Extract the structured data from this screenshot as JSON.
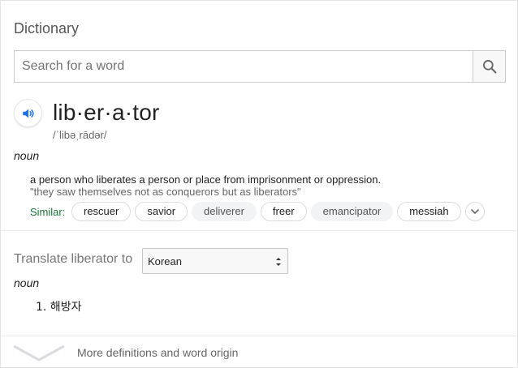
{
  "dictionary": {
    "title": "Dictionary",
    "search": {
      "placeholder": "Search for a word",
      "value": ""
    }
  },
  "entry": {
    "headword": "lib·er·a·tor",
    "phonetic": "/ˈlibəˌrādər/",
    "part_of_speech": "noun",
    "definition": "a person who liberates a person or place from imprisonment or oppression.",
    "example": "\"they saw themselves not as conquerors but as liberators\"",
    "similar_label": "Similar:",
    "similar": [
      "rescuer",
      "savior",
      "deliverer",
      "freer",
      "emancipator",
      "messiah"
    ]
  },
  "translate": {
    "label": "Translate liberator to",
    "selected_language": "Korean",
    "part_of_speech": "noun",
    "items": [
      "1. 해방자"
    ]
  },
  "footer": {
    "more_label": "More definitions and word origin"
  },
  "icons": {
    "search": "search-icon",
    "speaker": "speaker-icon",
    "chevron": "chevron-down-icon"
  },
  "colors": {
    "accent_blue": "#1a73e8",
    "similar_green": "#1a7a3c"
  }
}
